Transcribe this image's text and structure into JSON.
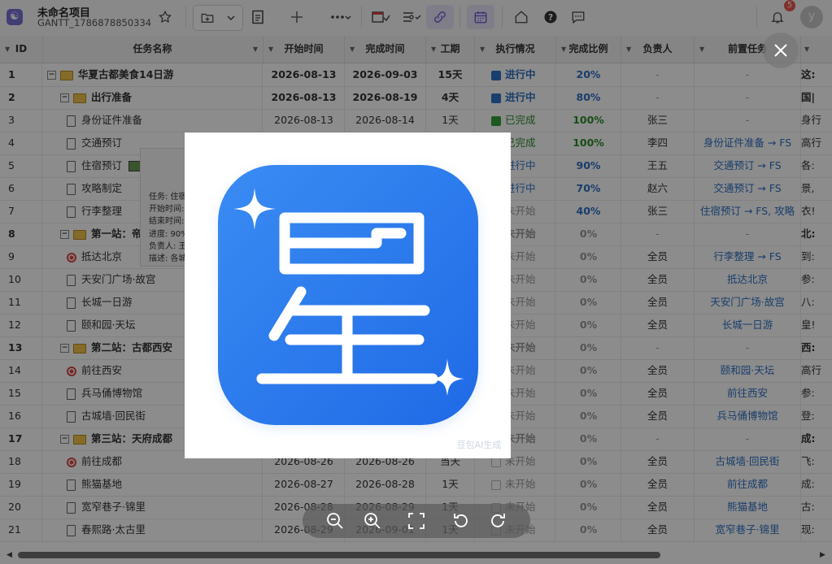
{
  "header": {
    "project_title": "未命名项目",
    "project_id": "GANTT_1786878850334",
    "notification_count": "5",
    "avatar_letter": "y"
  },
  "columns": [
    "ID",
    "任务名称",
    "开始时间",
    "完成时间",
    "工期",
    "执行情况",
    "完成比例",
    "负责人",
    "前置任务"
  ],
  "rows": [
    {
      "id": "1",
      "name": "华夏古都美食14日游",
      "start": "2026-08-13",
      "end": "2026-09-03",
      "dur": "15天",
      "status": "进行中",
      "pct": "20%",
      "owner": "-",
      "pre": "-",
      "extra": "这:",
      "level": 0,
      "kind": "folder",
      "group": true
    },
    {
      "id": "2",
      "name": "出行准备",
      "start": "2026-08-13",
      "end": "2026-08-19",
      "dur": "4天",
      "status": "进行中",
      "pct": "80%",
      "owner": "-",
      "pre": "-",
      "extra": "国|",
      "level": 1,
      "kind": "folder",
      "group": true
    },
    {
      "id": "3",
      "name": "身份证件准备",
      "start": "2026-08-13",
      "end": "2026-08-14",
      "dur": "1天",
      "status": "已完成",
      "pct": "100%",
      "owner": "张三",
      "pre": "-",
      "extra": "身行",
      "level": 2,
      "kind": "doc"
    },
    {
      "id": "4",
      "name": "交通预订",
      "start": "",
      "end": "",
      "dur": "",
      "status": "已完成",
      "pct": "100%",
      "owner": "李四",
      "pre": "身份证件准备 → FS",
      "extra": "高行",
      "level": 2,
      "kind": "doc"
    },
    {
      "id": "5",
      "name": "住宿预订",
      "start": "",
      "end": "",
      "dur": "",
      "status": "进行中",
      "pct": "90%",
      "owner": "王五",
      "pre": "交通预订 → FS",
      "extra": "各:",
      "level": 2,
      "kind": "doc",
      "img": true
    },
    {
      "id": "6",
      "name": "攻略制定",
      "start": "",
      "end": "",
      "dur": "",
      "status": "进行中",
      "pct": "70%",
      "owner": "赵六",
      "pre": "交通预订 → FS",
      "extra": "景,",
      "level": 2,
      "kind": "doc"
    },
    {
      "id": "7",
      "name": "行李整理",
      "start": "",
      "end": "",
      "dur": "",
      "status": "未开始",
      "pct": "40%",
      "owner": "张三",
      "pre": "住宿预订 → FS, 攻略",
      "extra": "衣!",
      "level": 2,
      "kind": "doc"
    },
    {
      "id": "8",
      "name": "第一站：帝",
      "start": "",
      "end": "",
      "dur": "",
      "status": "未开始",
      "pct": "0%",
      "owner": "-",
      "pre": "-",
      "extra": "北:",
      "level": 1,
      "kind": "folder",
      "group": true
    },
    {
      "id": "9",
      "name": "抵达北京",
      "start": "",
      "end": "",
      "dur": "",
      "status": "未开始",
      "pct": "0%",
      "owner": "全员",
      "pre": "行李整理 → FS",
      "extra": "到:",
      "level": 2,
      "kind": "target"
    },
    {
      "id": "10",
      "name": "天安门广场·故宫",
      "start": "",
      "end": "",
      "dur": "",
      "status": "未开始",
      "pct": "0%",
      "owner": "全员",
      "pre": "抵达北京",
      "extra": "参:",
      "level": 2,
      "kind": "doc"
    },
    {
      "id": "11",
      "name": "长城一日游",
      "start": "",
      "end": "",
      "dur": "",
      "status": "未开始",
      "pct": "0%",
      "owner": "全员",
      "pre": "天安门广场·故宫",
      "extra": "八:",
      "level": 2,
      "kind": "doc"
    },
    {
      "id": "12",
      "name": "颐和园·天坛",
      "start": "",
      "end": "",
      "dur": "",
      "status": "未开始",
      "pct": "0%",
      "owner": "全员",
      "pre": "长城一日游",
      "extra": "皇!",
      "level": 2,
      "kind": "doc"
    },
    {
      "id": "13",
      "name": "第二站：古都西安",
      "start": "",
      "end": "",
      "dur": "",
      "status": "未开始",
      "pct": "0%",
      "owner": "-",
      "pre": "-",
      "extra": "西:",
      "level": 1,
      "kind": "folder",
      "group": true
    },
    {
      "id": "14",
      "name": "前往西安",
      "start": "",
      "end": "",
      "dur": "",
      "status": "未开始",
      "pct": "0%",
      "owner": "全员",
      "pre": "颐和园·天坛",
      "extra": "高行",
      "level": 2,
      "kind": "target"
    },
    {
      "id": "15",
      "name": "兵马俑博物馆",
      "start": "",
      "end": "",
      "dur": "",
      "status": "未开始",
      "pct": "0%",
      "owner": "全员",
      "pre": "前往西安",
      "extra": "参:",
      "level": 2,
      "kind": "doc"
    },
    {
      "id": "16",
      "name": "古城墙·回民街",
      "start": "",
      "end": "",
      "dur": "",
      "status": "未开始",
      "pct": "0%",
      "owner": "全员",
      "pre": "兵马俑博物馆",
      "extra": "登:",
      "level": 2,
      "kind": "doc"
    },
    {
      "id": "17",
      "name": "第三站：天府成都",
      "start": "",
      "end": "",
      "dur": "",
      "status": "未开始",
      "pct": "0%",
      "owner": "-",
      "pre": "-",
      "extra": "成:",
      "level": 1,
      "kind": "folder",
      "group": true
    },
    {
      "id": "18",
      "name": "前往成都",
      "start": "2026-08-26",
      "end": "2026-08-26",
      "dur": "当天",
      "status": "未开始",
      "pct": "0%",
      "owner": "全员",
      "pre": "古城墙·回民街",
      "extra": "飞:",
      "level": 2,
      "kind": "target"
    },
    {
      "id": "19",
      "name": "熊猫基地",
      "start": "2026-08-27",
      "end": "2026-08-28",
      "dur": "1天",
      "status": "未开始",
      "pct": "0%",
      "owner": "全员",
      "pre": "前往成都",
      "extra": "成:",
      "level": 2,
      "kind": "doc"
    },
    {
      "id": "20",
      "name": "宽窄巷子·锦里",
      "start": "2026-08-28",
      "end": "2026-08-29",
      "dur": "1天",
      "status": "未开始",
      "pct": "0%",
      "owner": "全员",
      "pre": "熊猫基地",
      "extra": "古:",
      "level": 2,
      "kind": "doc"
    },
    {
      "id": "21",
      "name": "春熙路·太古里",
      "start": "2026-08-29",
      "end": "2026-09-01",
      "dur": "1天",
      "status": "未开始",
      "pct": "0%",
      "owner": "全员",
      "pre": "宽窄巷子·锦里",
      "extra": "现:",
      "level": 2,
      "kind": "doc"
    }
  ],
  "tooltip": {
    "lines": [
      "任务: 住宿",
      "开始时间:",
      "结束时间:",
      "进度: 90%",
      "负责人: 王",
      "描述: 各城"
    ]
  },
  "preview": {
    "watermark": "豆包AI生成"
  },
  "colors": {
    "status_progress": "#2f6fc4",
    "status_done": "#2a8d2a",
    "status_todo": "#999999",
    "icon_blue": "#2D7BF0"
  }
}
